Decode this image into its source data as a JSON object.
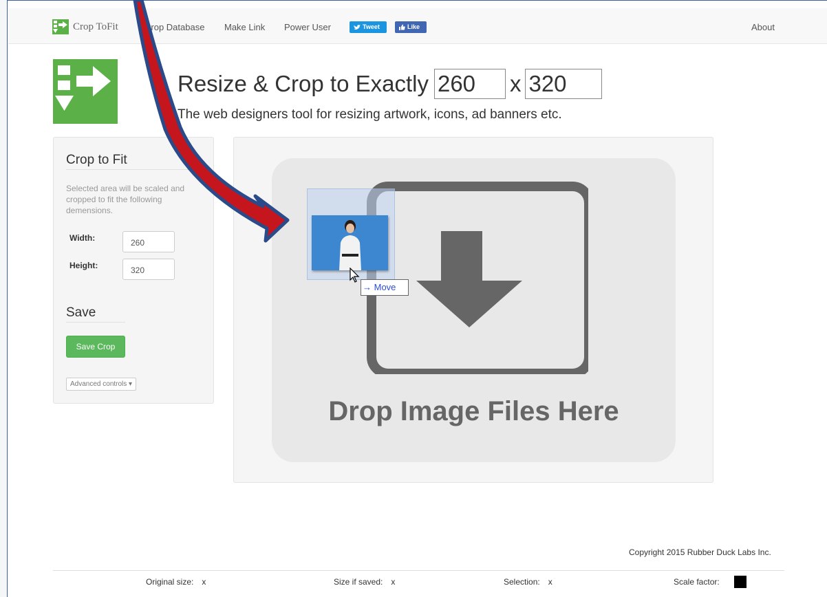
{
  "navbar": {
    "brand": "Crop ToFit",
    "links": [
      "Crop Database",
      "Make Link",
      "Power User"
    ],
    "tweet_label": "Tweet",
    "like_label": "Like",
    "about_label": "About"
  },
  "hero": {
    "title_prefix": "Resize & Crop to Exactly",
    "width_value": "260",
    "separator": "x",
    "height_value": "320",
    "subtitle": "The web designers tool for resizing artwork, icons, ad banners etc."
  },
  "panel": {
    "title": "Crop to Fit",
    "description": "Selected area will be scaled and cropped to fit the following demensions.",
    "width_label": "Width:",
    "width_value": "260",
    "height_label": "Height:",
    "height_value": "320",
    "save_title": "Save",
    "save_button": "Save Crop",
    "advanced_button": "Advanced controls ▾"
  },
  "dropzone": {
    "text": "Drop Image Files Here",
    "drag_tooltip": "Move"
  },
  "footer": {
    "copyright": "Copyright 2015 Rubber Duck Labs Inc.",
    "original_size_label": "Original size:",
    "original_size_value": "x",
    "size_saved_label": "Size if saved:",
    "size_saved_value": "x",
    "selection_label": "Selection:",
    "selection_value": "x",
    "scale_factor_label": "Scale factor:"
  },
  "colors": {
    "brand_green": "#5bb147",
    "save_green": "#5cb85c",
    "tweet_blue": "#1b95e0",
    "like_blue": "#4267b2",
    "arrow_red": "#c4161c",
    "arrow_outline": "#2b4a8a"
  }
}
